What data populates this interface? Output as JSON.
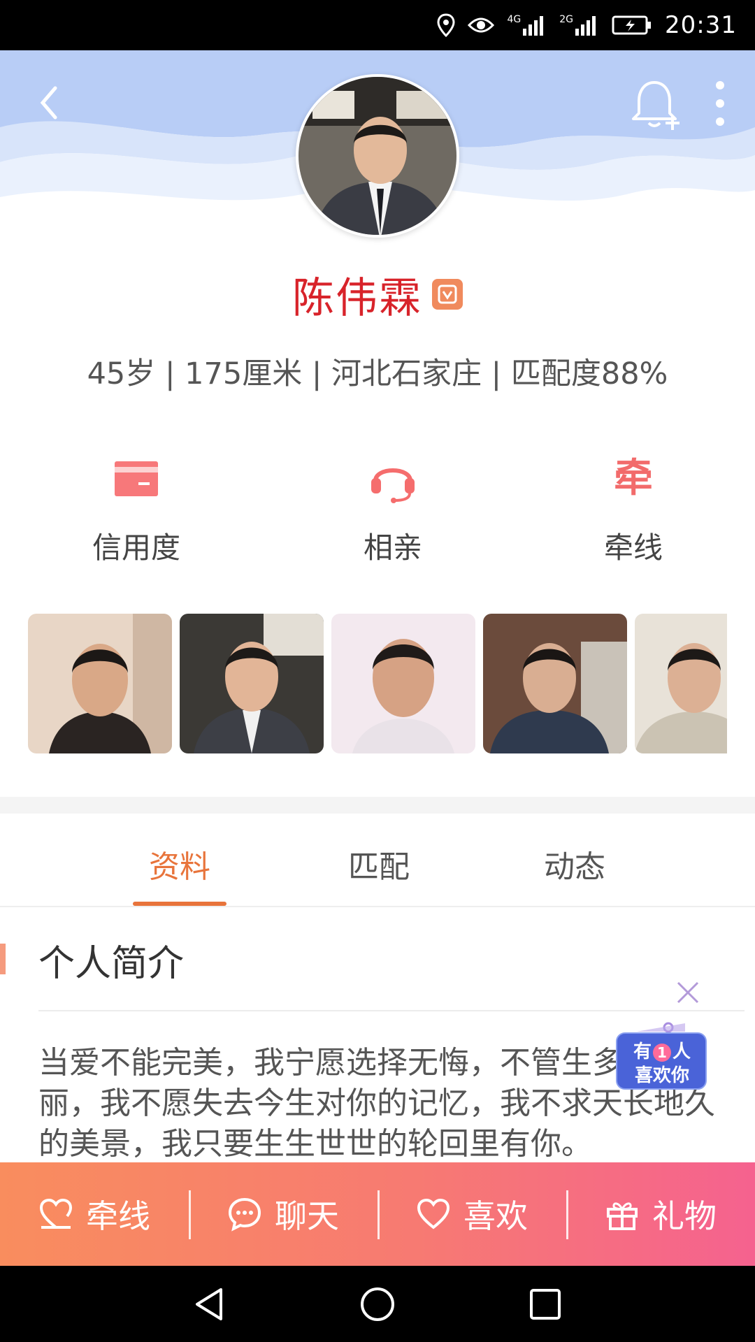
{
  "status_bar": {
    "time": "20:31",
    "network_1": "4G",
    "network_2": "2G"
  },
  "header": {
    "back_icon": "chevron-left-icon",
    "bell_icon": "bell-add-icon",
    "more_icon": "more-vertical-icon"
  },
  "profile": {
    "name": "陈伟霖",
    "verified_icon": "verified-v-icon",
    "info_line": "45岁 | 175厘米 | 河北石家庄 | 匹配度88%"
  },
  "features": [
    {
      "label": "信用度",
      "icon": "credit-card-icon"
    },
    {
      "label": "相亲",
      "icon": "headset-icon"
    },
    {
      "label": "牵线",
      "icon": "qian-glyph-icon",
      "glyph": "牵"
    }
  ],
  "photos_count": 5,
  "tabs": [
    {
      "label": "资料",
      "active": true
    },
    {
      "label": "匹配",
      "active": false
    },
    {
      "label": "动态",
      "active": false
    }
  ],
  "intro": {
    "title": "个人简介",
    "text": "当爱不能完美，我宁愿选择无悔，不管生多么美丽，我不愿失去今生对你的记忆，我不求天长地久的美景，我只要生生世世的轮回里有你。"
  },
  "float_badge": {
    "line1_a": "有",
    "line1_num": "1",
    "line1_b": "人",
    "line2": "喜欢你"
  },
  "actions": [
    {
      "label": "牵线",
      "icon": "heart-hand-icon"
    },
    {
      "label": "聊天",
      "icon": "chat-bubble-icon"
    },
    {
      "label": "喜欢",
      "icon": "heart-icon"
    },
    {
      "label": "礼物",
      "icon": "gift-icon"
    }
  ],
  "colors": {
    "name": "#d8232a",
    "accent": "#e8743b",
    "action_bar_start": "#f98d5e",
    "action_bar_end": "#f5628f",
    "header_wave": "#b8cdf6"
  }
}
